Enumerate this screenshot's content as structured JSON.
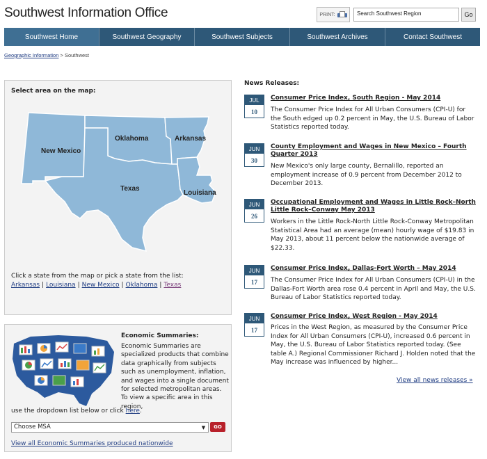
{
  "header": {
    "title": "Southwest Information Office",
    "print_label": "PRINT:",
    "search_value": "Search Southwest Region",
    "search_button": "Go"
  },
  "nav": {
    "items": [
      {
        "label": "Southwest Home",
        "active": true
      },
      {
        "label": "Southwest Geography"
      },
      {
        "label": "Southwest Subjects"
      },
      {
        "label": "Southwest Archives"
      },
      {
        "label": "Contact Southwest"
      }
    ]
  },
  "breadcrumb": {
    "link": "Geographic Information",
    "separator": ">",
    "current": "Southwest"
  },
  "map_panel": {
    "heading": "Select area on the map:",
    "states": [
      "New Mexico",
      "Oklahoma",
      "Arkansas",
      "Texas",
      "Louisiana"
    ],
    "caption": "Click a state from the map or pick a state from the list:",
    "links": [
      "Arkansas",
      "Louisiana",
      "New Mexico",
      "Oklahoma",
      "Texas"
    ],
    "link_separator": "|",
    "map_fill": "#8fb8d8",
    "map_stroke": "#ffffff"
  },
  "econ_panel": {
    "heading": "Economic Summaries:",
    "text": "Economic Summaries are specialized products that combine data graphically from subjects such as unemployment, inflation, and wages into a single document for selected metropolitan areas. To view a specific area in this region,",
    "text2_prefix": "use the dropdown list below or click",
    "text2_link": "here",
    "text2_suffix": ".",
    "select_value": "Choose MSA",
    "go_label": "GO",
    "view_all": "View all Economic Summaries produced nationwide"
  },
  "news": {
    "heading": "News Releases:",
    "items": [
      {
        "month": "JUL",
        "day": "10",
        "title": "Consumer Price Index, South Region - May 2014",
        "desc": "The Consumer Price Index for All Urban Consumers (CPI-U) for the South edged up 0.2 percent in May, the U.S. Bureau of Labor Statistics reported today."
      },
      {
        "month": "JUN",
        "day": "30",
        "title": "County Employment and Wages in New Mexico – Fourth Quarter 2013",
        "desc": "New Mexico's only large county, Bernalillo, reported an employment increase of 0.9 percent from December 2012 to December 2013."
      },
      {
        "month": "JUN",
        "day": "26",
        "title": "Occupational Employment and Wages in Little Rock–North Little Rock–Conway May 2013",
        "desc": "Workers in the Little Rock-North Little Rock-Conway Metropolitan Statistical Area had an average (mean) hourly wage of $19.83 in May 2013, about 11 percent below the nationwide average of $22.33."
      },
      {
        "month": "JUN",
        "day": "17",
        "title": "Consumer Price Index, Dallas-Fort Worth – May 2014",
        "desc": "The Consumer Price Index for All Urban Consumers (CPI-U) in the Dallas-Fort Worth area rose 0.4 percent in April and May, the U.S. Bureau of Labor Statistics reported today."
      },
      {
        "month": "JUN",
        "day": "17",
        "title": "Consumer Price Index, West Region - May 2014",
        "desc": "Prices in the West Region, as measured by the Consumer Price Index for All Urban Consumers (CPI-U), increased 0.6 percent in May, the U.S. Bureau of Labor Statistics reported today. (See table A.) Regional Commissioner Richard J. Holden noted that the May increase was influenced by higher..."
      }
    ],
    "view_all": "View all news releases »"
  },
  "colors": {
    "nav_bg": "#2e5878",
    "nav_active": "#3f6f93",
    "badge": "#2e5878",
    "go_red": "#b8202a",
    "link": "#1f3c82"
  }
}
